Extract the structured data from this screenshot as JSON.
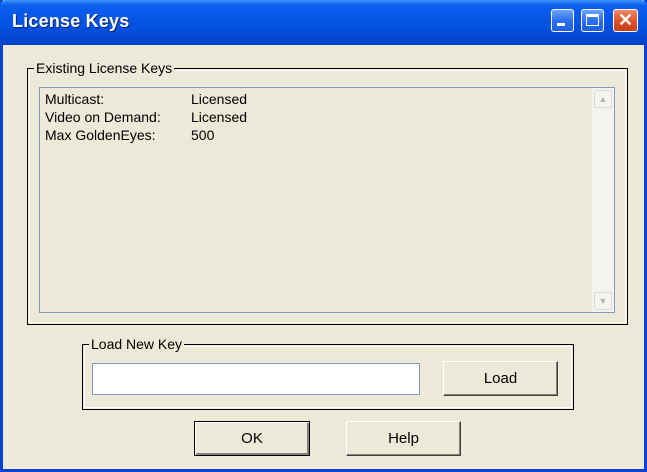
{
  "window": {
    "title": "License Keys",
    "title_color": "#ffffff",
    "titlebar_color": "#0554e4",
    "controls": {
      "minimize_icon": "minimize-icon",
      "maximize_icon": "maximize-icon",
      "close_icon": "close-icon",
      "close_glyph": "✕"
    }
  },
  "existing_keys": {
    "group_label": "Existing License Keys",
    "items": [
      {
        "key": "Multicast:",
        "value": "Licensed"
      },
      {
        "key": "Video on Demand:",
        "value": "Licensed"
      },
      {
        "key": "Max GoldenEyes:",
        "value": "500"
      }
    ],
    "scrollbar": {
      "up_icon": "scroll-up-arrow-icon",
      "down_icon": "scroll-down-arrow-icon",
      "up_glyph": "▲",
      "down_glyph": "▼"
    }
  },
  "load_key": {
    "group_label": "Load New Key",
    "input_value": "",
    "input_placeholder": "",
    "load_label": "Load"
  },
  "footer": {
    "ok_label": "OK",
    "help_label": "Help"
  }
}
